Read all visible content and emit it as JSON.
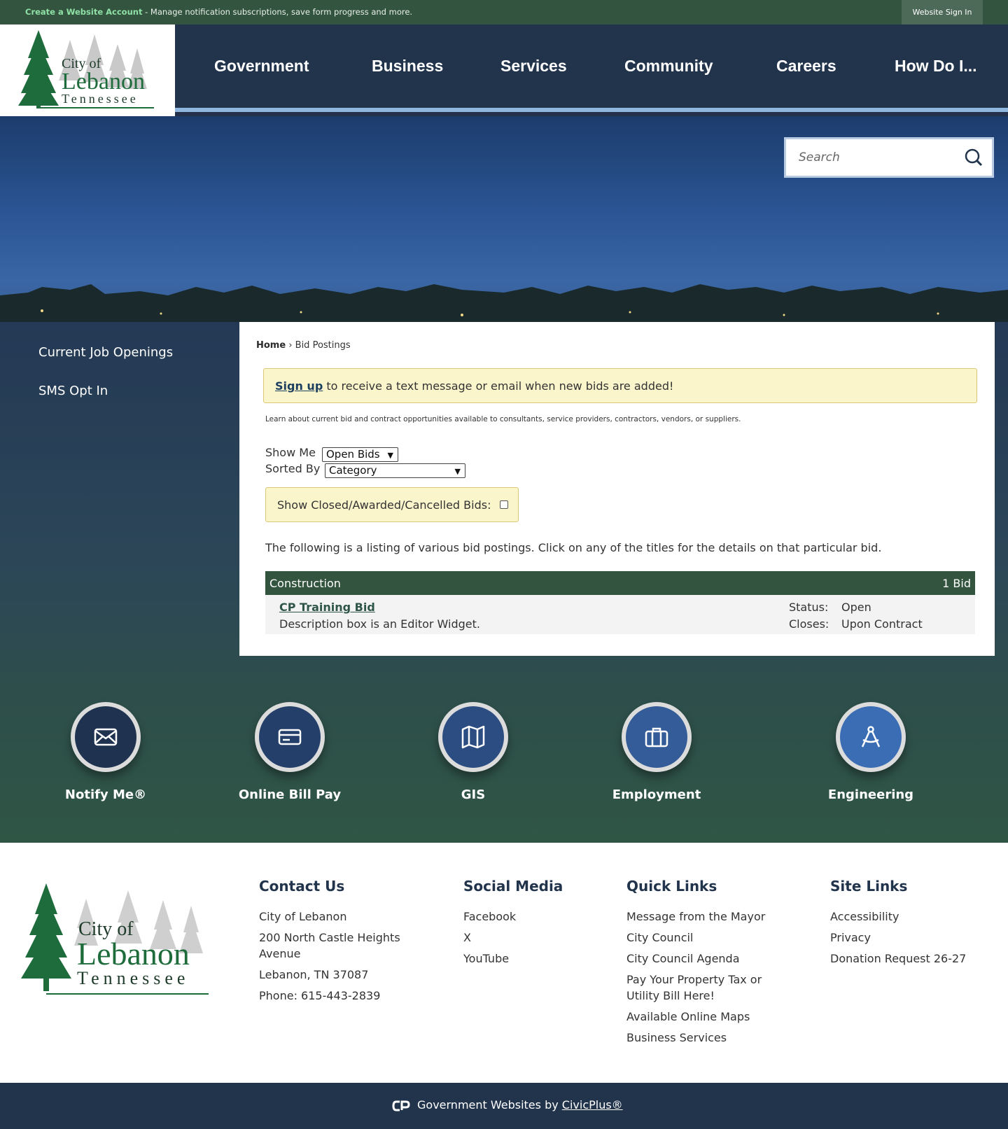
{
  "topbar": {
    "create_account_link": "Create a Website Account",
    "create_account_desc": " - Manage notification subscriptions, save form progress and more.",
    "sign_in": "Website Sign In"
  },
  "logo": {
    "line1": "City of",
    "line2": "Lebanon",
    "line3": "Tennessee"
  },
  "nav": {
    "items": [
      {
        "label": "Government"
      },
      {
        "label": "Business"
      },
      {
        "label": "Services"
      },
      {
        "label": "Community"
      },
      {
        "label": "Careers"
      },
      {
        "label": "How Do I..."
      }
    ]
  },
  "search": {
    "placeholder": "Search"
  },
  "sidebar": {
    "items": [
      {
        "label": "Current Job Openings"
      },
      {
        "label": "SMS Opt In"
      }
    ]
  },
  "breadcrumb": {
    "home": "Home",
    "separator": " › ",
    "current": "Bid Postings"
  },
  "notice": {
    "link": "Sign up",
    "text": " to receive a text message or email when new bids are added!"
  },
  "learn_text": "Learn about current bid and contract opportunities available to consultants, service providers, contractors, vendors, or suppliers.",
  "filters": {
    "show_me_label": "Show Me",
    "show_me_value": "Open Bids",
    "sorted_by_label": "Sorted By",
    "sorted_by_value": "Category",
    "closed_label": "Show Closed/Awarded/Cancelled Bids:"
  },
  "intro_text": "The following is a listing of various bid postings. Click on any of the titles for the details on that particular bid.",
  "category": {
    "name": "Construction",
    "count": "1 Bid"
  },
  "bid": {
    "title": "CP Training Bid",
    "description": "Description box is an Editor Widget.",
    "status_label": "Status:",
    "status_value": "Open",
    "closes_label": "Closes:",
    "closes_value": "Upon Contract"
  },
  "quick_links": [
    {
      "label": "Notify Me®",
      "icon": "envelope-icon",
      "color": "#1f3350"
    },
    {
      "label": "Online Bill Pay",
      "icon": "credit-card-icon",
      "color": "#24406a"
    },
    {
      "label": "GIS",
      "icon": "map-icon",
      "color": "#2b4d82"
    },
    {
      "label": "Employment",
      "icon": "briefcase-icon",
      "color": "#335c98"
    },
    {
      "label": "Engineering",
      "icon": "compass-icon",
      "color": "#3a6db3"
    }
  ],
  "footer": {
    "contact": {
      "heading": "Contact Us",
      "name": "City of Lebanon",
      "address1": "200 North Castle Heights Avenue",
      "address2": "Lebanon, TN 37087",
      "phone": "Phone: 615-443-2839"
    },
    "social": {
      "heading": "Social Media",
      "items": [
        "Facebook",
        "X",
        "YouTube"
      ]
    },
    "quick": {
      "heading": "Quick Links",
      "items": [
        "Message from the Mayor",
        "City Council",
        "City Council Agenda",
        "Pay Your Property Tax or Utility Bill Here!",
        "Available Online Maps",
        "Business Services"
      ]
    },
    "site": {
      "heading": "Site Links",
      "items": [
        "Accessibility",
        "Privacy",
        "Donation Request 26-27"
      ]
    }
  },
  "bottombar": {
    "prefix": "Government Websites by ",
    "link": "CivicPlus®"
  },
  "colors": {
    "brand_green": "#33553f",
    "navy": "#22344c",
    "notice_yellow": "#fbf5cc"
  }
}
